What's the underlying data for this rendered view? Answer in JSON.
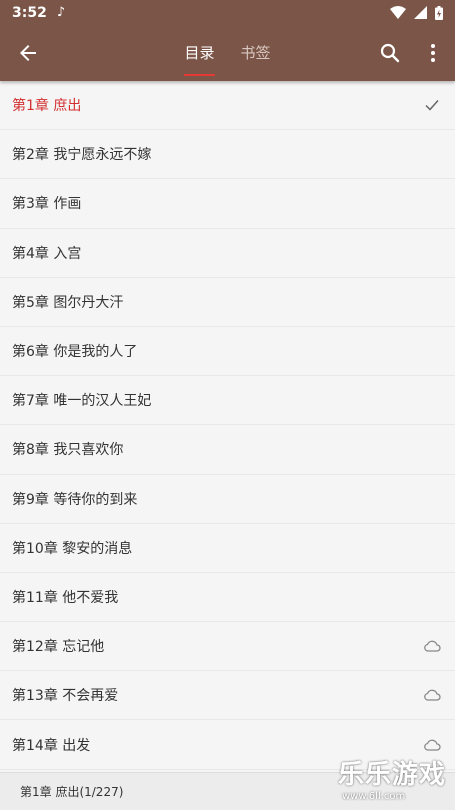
{
  "status_bar": {
    "time": "3:52",
    "notification_icon": "tiktok-icon"
  },
  "app_bar": {
    "tabs": [
      {
        "label": "目录",
        "active": true
      },
      {
        "label": "书签",
        "active": false
      }
    ],
    "accent_color": "#7b5648",
    "indicator_color": "#e53935"
  },
  "chapters": [
    {
      "title": "第1章 庶出",
      "current": true,
      "status": "check-icon"
    },
    {
      "title": "第2章 我宁愿永远不嫁",
      "current": false,
      "status": ""
    },
    {
      "title": "第3章 作画",
      "current": false,
      "status": ""
    },
    {
      "title": "第4章 入宫",
      "current": false,
      "status": ""
    },
    {
      "title": "第5章 图尔丹大汗",
      "current": false,
      "status": ""
    },
    {
      "title": "第6章 你是我的人了",
      "current": false,
      "status": ""
    },
    {
      "title": "第7章 唯一的汉人王妃",
      "current": false,
      "status": ""
    },
    {
      "title": "第8章 我只喜欢你",
      "current": false,
      "status": ""
    },
    {
      "title": "第9章 等待你的到来",
      "current": false,
      "status": ""
    },
    {
      "title": "第10章 黎安的消息",
      "current": false,
      "status": ""
    },
    {
      "title": "第11章 他不爱我",
      "current": false,
      "status": ""
    },
    {
      "title": "第12章 忘记他",
      "current": false,
      "status": "cloud-icon"
    },
    {
      "title": "第13章 不会再爱",
      "current": false,
      "status": "cloud-icon"
    },
    {
      "title": "第14章 出发",
      "current": false,
      "status": "cloud-icon"
    }
  ],
  "footer": {
    "progress_text": "第1章 庶出(1/227)"
  },
  "watermark": {
    "name": "乐乐游戏",
    "url": "www.6ll.com"
  }
}
